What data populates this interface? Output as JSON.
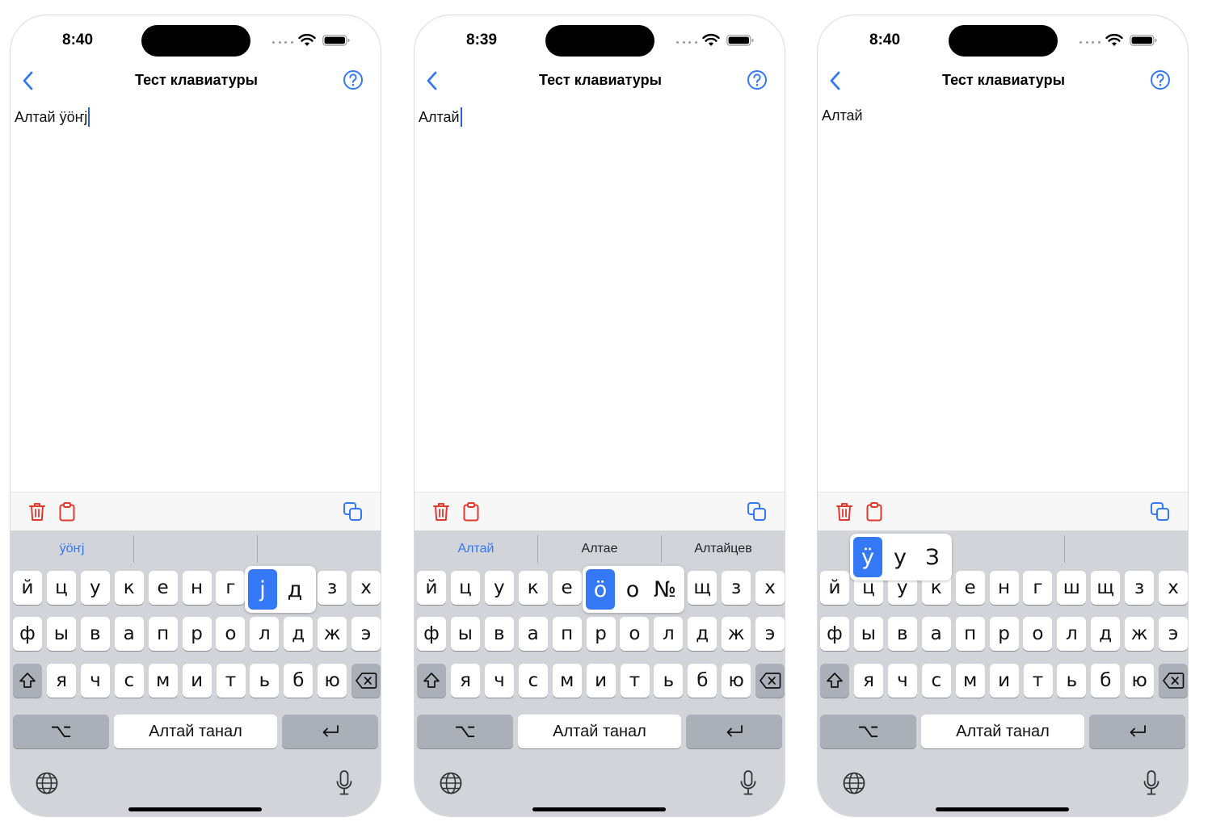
{
  "colors": {
    "accent": "#3478f6",
    "danger": "#e0392e",
    "keyboard": "#d2d4da",
    "caret": "#2e5bd9"
  },
  "screens": [
    {
      "time": "8:40",
      "nav": {
        "title": "Тест клавиатуры"
      },
      "text": "Алтай ӱӧҥј",
      "cursor": true,
      "suggestions": [
        {
          "text": "ӱӧҥј",
          "highlighted": true
        },
        {
          "text": ""
        },
        {
          "text": ""
        }
      ],
      "rows": [
        [
          "й",
          "ц",
          "у",
          "к",
          "е",
          "н",
          "г",
          "ј",
          "д",
          "з",
          "х"
        ],
        [
          "ф",
          "ы",
          "в",
          "а",
          "п",
          "р",
          "о",
          "л",
          "д",
          "ж",
          "э"
        ],
        [
          "я",
          "ч",
          "с",
          "м",
          "и",
          "т",
          "ь",
          "б",
          "ю"
        ]
      ],
      "space_label": "Алтай танал",
      "option_key_label": "⌥",
      "popup": {
        "chars": [
          "ј",
          "д"
        ],
        "selected": 0
      }
    },
    {
      "time": "8:39",
      "nav": {
        "title": "Тест клавиатуры"
      },
      "text": "Алтай",
      "cursor": true,
      "suggestions": [
        {
          "text": "Алтай",
          "highlighted": true
        },
        {
          "text": "Алтае"
        },
        {
          "text": "Алтайцев"
        }
      ],
      "rows": [
        [
          "й",
          "ц",
          "у",
          "к",
          "е",
          "ӧ",
          "о",
          "№",
          "щ",
          "з",
          "х"
        ],
        [
          "ф",
          "ы",
          "в",
          "а",
          "п",
          "р",
          "о",
          "л",
          "д",
          "ж",
          "э"
        ],
        [
          "я",
          "ч",
          "с",
          "м",
          "и",
          "т",
          "ь",
          "б",
          "ю"
        ]
      ],
      "space_label": "Алтай танал",
      "option_key_label": "⌥",
      "popup": {
        "chars": [
          "ӧ",
          "о",
          "№"
        ],
        "selected": 0
      }
    },
    {
      "time": "8:40",
      "nav": {
        "title": "Тест клавиатуры"
      },
      "text": "Алтай",
      "cursor": false,
      "suggestions": [
        {
          "text": ""
        },
        {
          "text": ""
        },
        {
          "text": ""
        }
      ],
      "rows": [
        [
          "й",
          "ц",
          "у",
          "к",
          "е",
          "н",
          "г",
          "ш",
          "щ",
          "з",
          "х"
        ],
        [
          "ф",
          "ы",
          "в",
          "а",
          "п",
          "р",
          "о",
          "л",
          "д",
          "ж",
          "э"
        ],
        [
          "я",
          "ч",
          "с",
          "м",
          "и",
          "т",
          "ь",
          "б",
          "ю"
        ]
      ],
      "space_label": "Алтай танал",
      "option_key_label": "⌥",
      "popup": {
        "chars": [
          "ӱ",
          "у",
          "З"
        ],
        "selected": 0
      }
    }
  ]
}
